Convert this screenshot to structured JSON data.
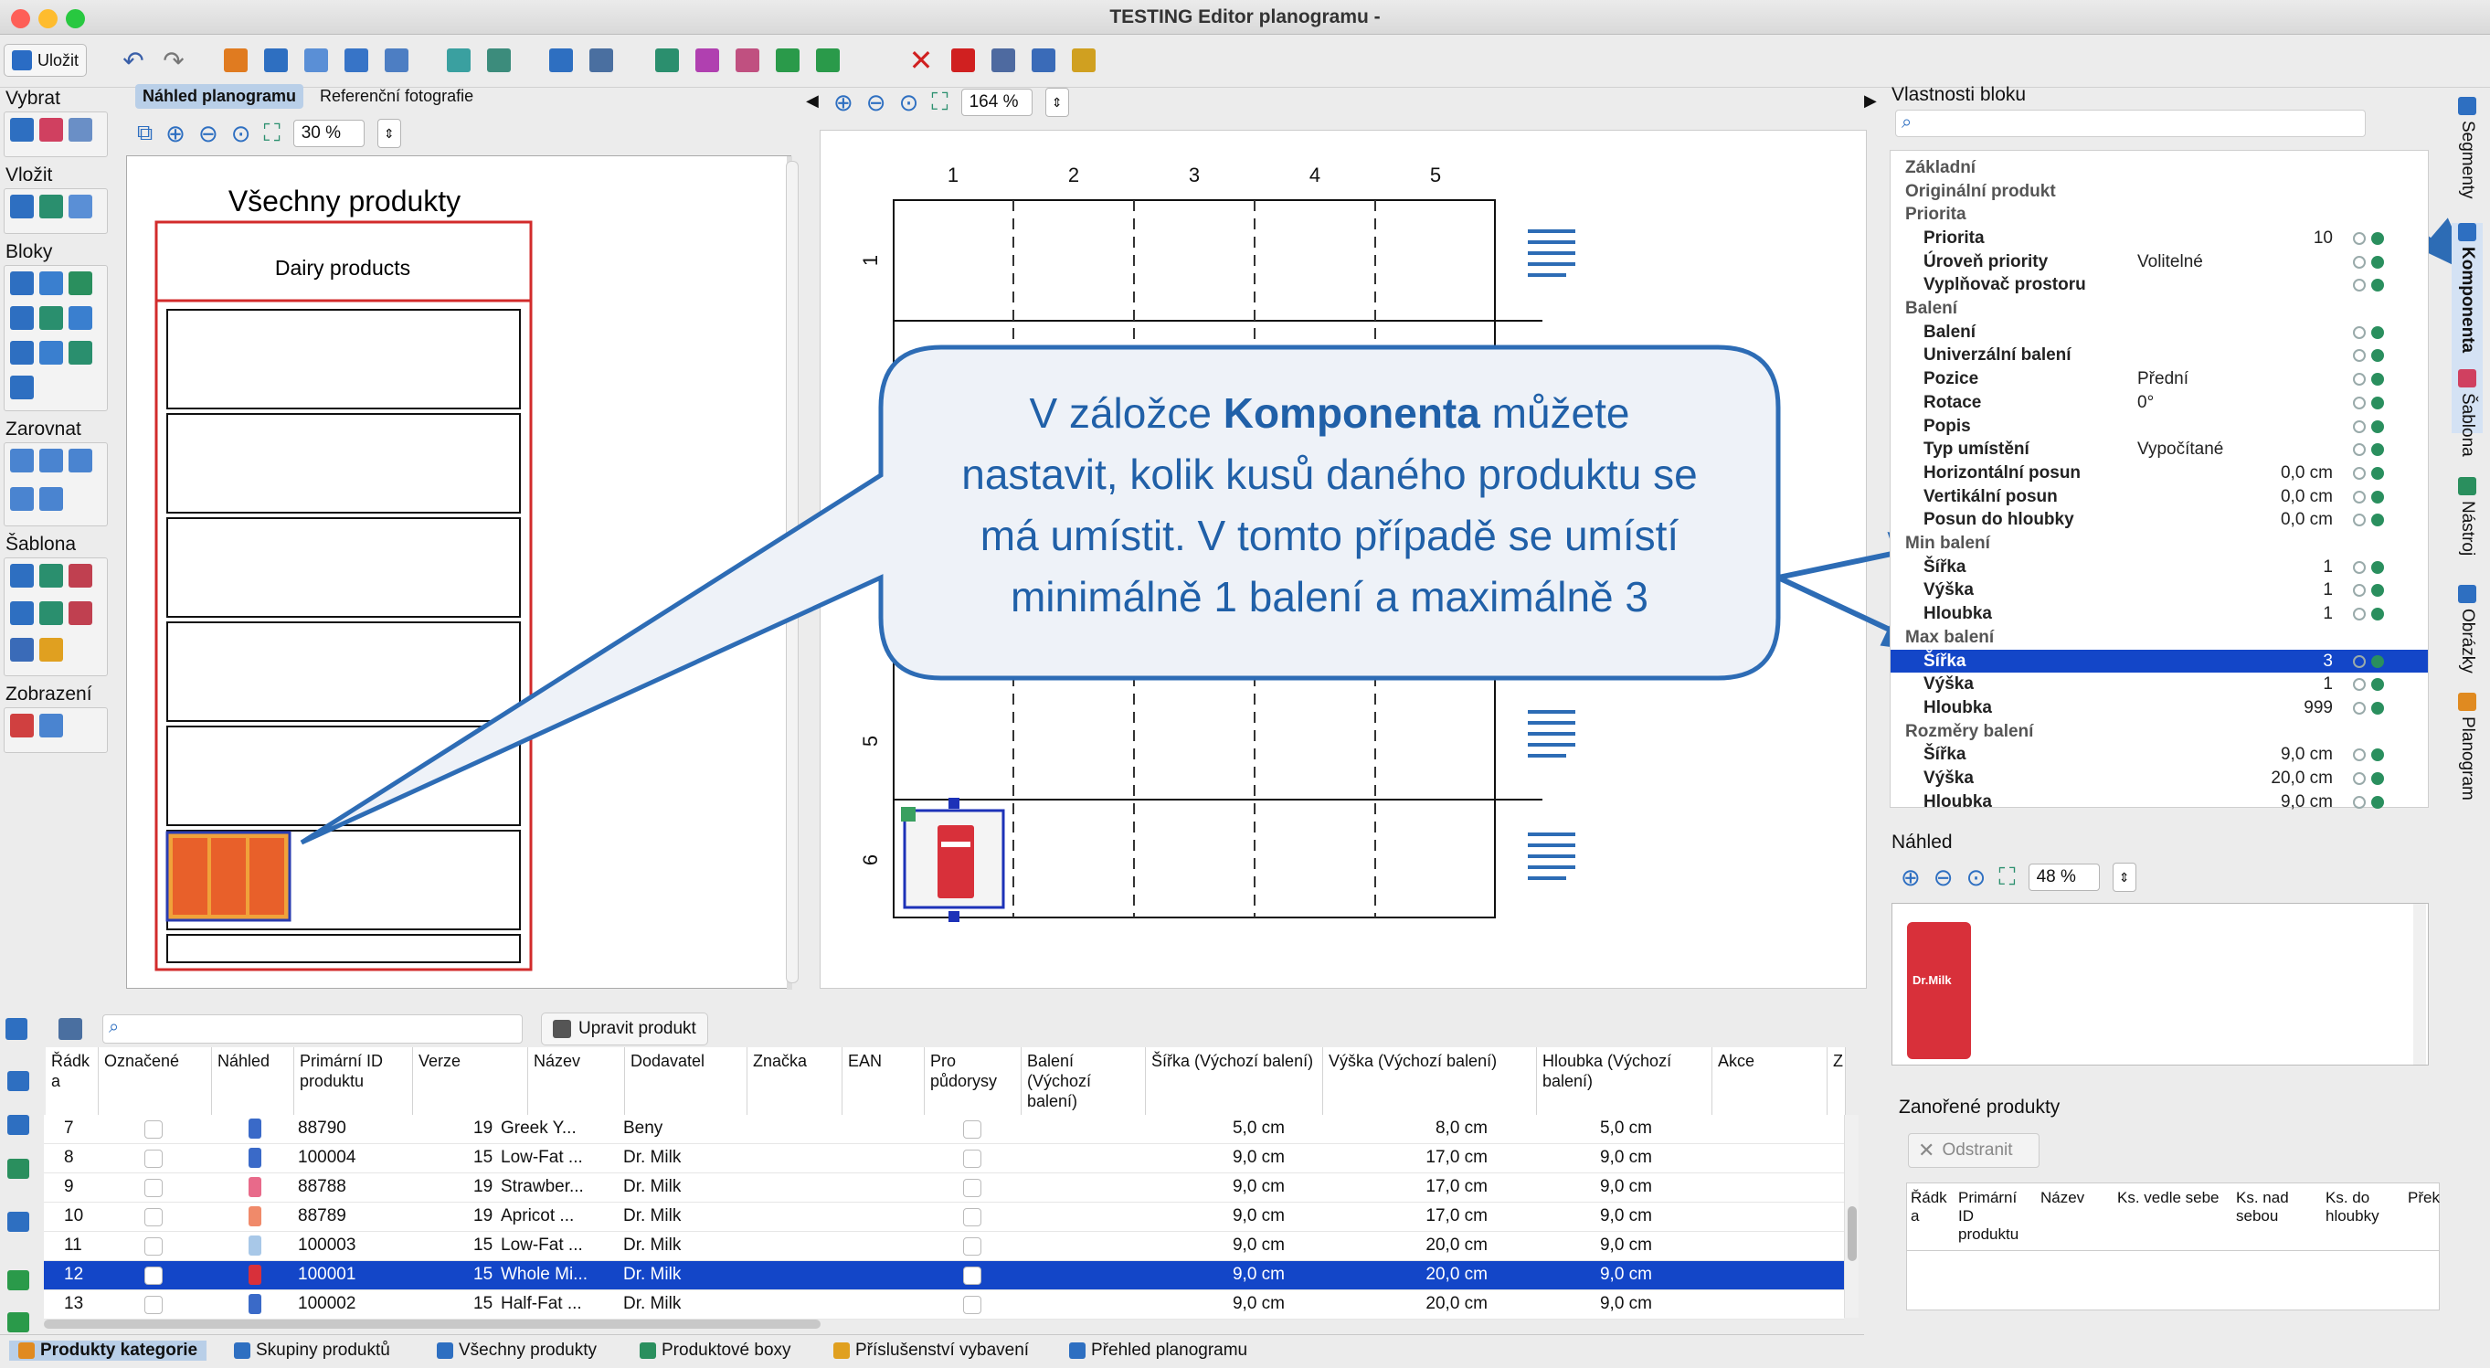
{
  "window": {
    "title": "TESTING Editor planogramu -"
  },
  "toolbar": {
    "save_label": "Uložit"
  },
  "left_panel": {
    "sections": [
      "Vybrat",
      "Vložit",
      "Bloky",
      "Zarovnat",
      "Šablona",
      "Zobrazení"
    ]
  },
  "preview_tabs": [
    "Náhled planogramu",
    "Referenční fotografie"
  ],
  "left_zoom": "30 %",
  "right_zoom": "164 %",
  "planogram_left": {
    "title": "Všechny produkty",
    "segment": "Dairy products"
  },
  "planogram_right": {
    "columns": [
      "1",
      "2",
      "3",
      "4",
      "5"
    ],
    "rows": [
      "1",
      "5",
      "6"
    ]
  },
  "callout": {
    "line1_pre": "V záložce ",
    "line1_bold": "Komponenta",
    "line1_post": " můžete",
    "line2": "nastavit, kolik kusů daného produktu se",
    "line3": "má umístit. V tomto případě se umístí",
    "line4": "minimálně 1 balení a maximálně 3"
  },
  "properties": {
    "title": "Vlastnosti bloku",
    "rows": [
      {
        "type": "section",
        "label": "Základní"
      },
      {
        "type": "section",
        "label": "Originální produkt"
      },
      {
        "type": "section",
        "label": "Priorita"
      },
      {
        "type": "row",
        "label": "Priorita",
        "value": "",
        "value_right": "10"
      },
      {
        "type": "row",
        "label": "Úroveň priority",
        "value": "Volitelné",
        "value_right": ""
      },
      {
        "type": "row",
        "label": "Vyplňovač prostoru",
        "value": "",
        "value_right": ""
      },
      {
        "type": "section",
        "label": "Balení"
      },
      {
        "type": "row",
        "label": "Balení",
        "value": "",
        "value_right": ""
      },
      {
        "type": "row",
        "label": "Univerzální balení",
        "value": "",
        "value_right": ""
      },
      {
        "type": "row",
        "label": "Pozice",
        "value": "Přední",
        "value_right": ""
      },
      {
        "type": "row",
        "label": "Rotace",
        "value": "0°",
        "value_right": ""
      },
      {
        "type": "row",
        "label": "Popis",
        "value": "",
        "value_right": ""
      },
      {
        "type": "row",
        "label": "Typ umístění",
        "value": "Vypočítané",
        "value_right": ""
      },
      {
        "type": "row",
        "label": "Horizontální posun",
        "value": "",
        "value_right": "0,0 cm"
      },
      {
        "type": "row",
        "label": "Vertikální posun",
        "value": "",
        "value_right": "0,0 cm"
      },
      {
        "type": "row",
        "label": "Posun do hloubky",
        "value": "",
        "value_right": "0,0 cm"
      },
      {
        "type": "section",
        "label": "Min balení"
      },
      {
        "type": "row",
        "label": "Šířka",
        "value": "",
        "value_right": "1"
      },
      {
        "type": "row",
        "label": "Výška",
        "value": "",
        "value_right": "1"
      },
      {
        "type": "row",
        "label": "Hloubka",
        "value": "",
        "value_right": "1"
      },
      {
        "type": "section",
        "label": "Max balení"
      },
      {
        "type": "row",
        "label": "Šířka",
        "value": "",
        "value_right": "3",
        "selected": true
      },
      {
        "type": "row",
        "label": "Výška",
        "value": "",
        "value_right": "1"
      },
      {
        "type": "row",
        "label": "Hloubka",
        "value": "",
        "value_right": "999"
      },
      {
        "type": "section",
        "label": "Rozměry balení"
      },
      {
        "type": "row",
        "label": "Šířka",
        "value": "",
        "value_right": "9,0 cm"
      },
      {
        "type": "row",
        "label": "Výška",
        "value": "",
        "value_right": "20,0 cm"
      },
      {
        "type": "row",
        "label": "Hloubka",
        "value": "",
        "value_right": "9,0 cm"
      }
    ]
  },
  "side_tabs": [
    "Segmenty",
    "Komponenta",
    "Šablona",
    "Nástroj",
    "Obrázky",
    "Planogram"
  ],
  "preview": {
    "title": "Náhled",
    "zoom": "48 %",
    "product_brand": "Dr.Milk"
  },
  "nested": {
    "title": "Zanořené produkty",
    "remove_label": "Odstranit",
    "columns": [
      "Řádk a",
      "Primární ID produktu",
      "Název",
      "Ks. vedle sebe",
      "Ks. nad sebou",
      "Ks. do hloubky",
      "Přek"
    ]
  },
  "table": {
    "edit_button": "Upravit produkt",
    "columns": [
      "Řádk a",
      "Označené",
      "Náhled",
      "Primární ID produktu",
      "Verze",
      "Název",
      "Dodavatel",
      "Značka",
      "EAN",
      "Pro půdorysy",
      "Balení (Výchozí balení)",
      "Šířka (Výchozí balení)",
      "Výška (Výchozí balení)",
      "Hloubka (Výchozí balení)",
      "Akce",
      "Z"
    ],
    "rows": [
      {
        "n": "7",
        "id": "88790",
        "ver": "19",
        "name": "Greek Y...",
        "sup": "Beny",
        "w": "5,0 cm",
        "h": "8,0 cm",
        "d": "5,0 cm"
      },
      {
        "n": "8",
        "id": "100004",
        "ver": "15",
        "name": "Low-Fat ...",
        "sup": "Dr. Milk",
        "w": "9,0 cm",
        "h": "17,0 cm",
        "d": "9,0 cm"
      },
      {
        "n": "9",
        "id": "88788",
        "ver": "19",
        "name": "Strawber...",
        "sup": "Dr. Milk",
        "w": "9,0 cm",
        "h": "17,0 cm",
        "d": "9,0 cm"
      },
      {
        "n": "10",
        "id": "88789",
        "ver": "19",
        "name": "Apricot ...",
        "sup": "Dr. Milk",
        "w": "9,0 cm",
        "h": "17,0 cm",
        "d": "9,0 cm"
      },
      {
        "n": "11",
        "id": "100003",
        "ver": "15",
        "name": "Low-Fat ...",
        "sup": "Dr. Milk",
        "w": "9,0 cm",
        "h": "20,0 cm",
        "d": "9,0 cm"
      },
      {
        "n": "12",
        "id": "100001",
        "ver": "15",
        "name": "Whole Mi...",
        "sup": "Dr. Milk",
        "w": "9,0 cm",
        "h": "20,0 cm",
        "d": "9,0 cm",
        "selected": true
      },
      {
        "n": "13",
        "id": "100002",
        "ver": "15",
        "name": "Half-Fat ...",
        "sup": "Dr. Milk",
        "w": "9,0 cm",
        "h": "20,0 cm",
        "d": "9,0 cm"
      }
    ]
  },
  "bottom_tabs": [
    "Produkty kategorie",
    "Skupiny produktů",
    "Všechny produkty",
    "Produktové boxy",
    "Příslušenství vybavení",
    "Přehled planogramu"
  ],
  "colors": {
    "accent": "#1346c8",
    "callout_fill": "#eef2f8",
    "callout_stroke": "#2d6cb5",
    "arrow": "#2d6cb5",
    "shelf_red": "#d22b2b"
  }
}
